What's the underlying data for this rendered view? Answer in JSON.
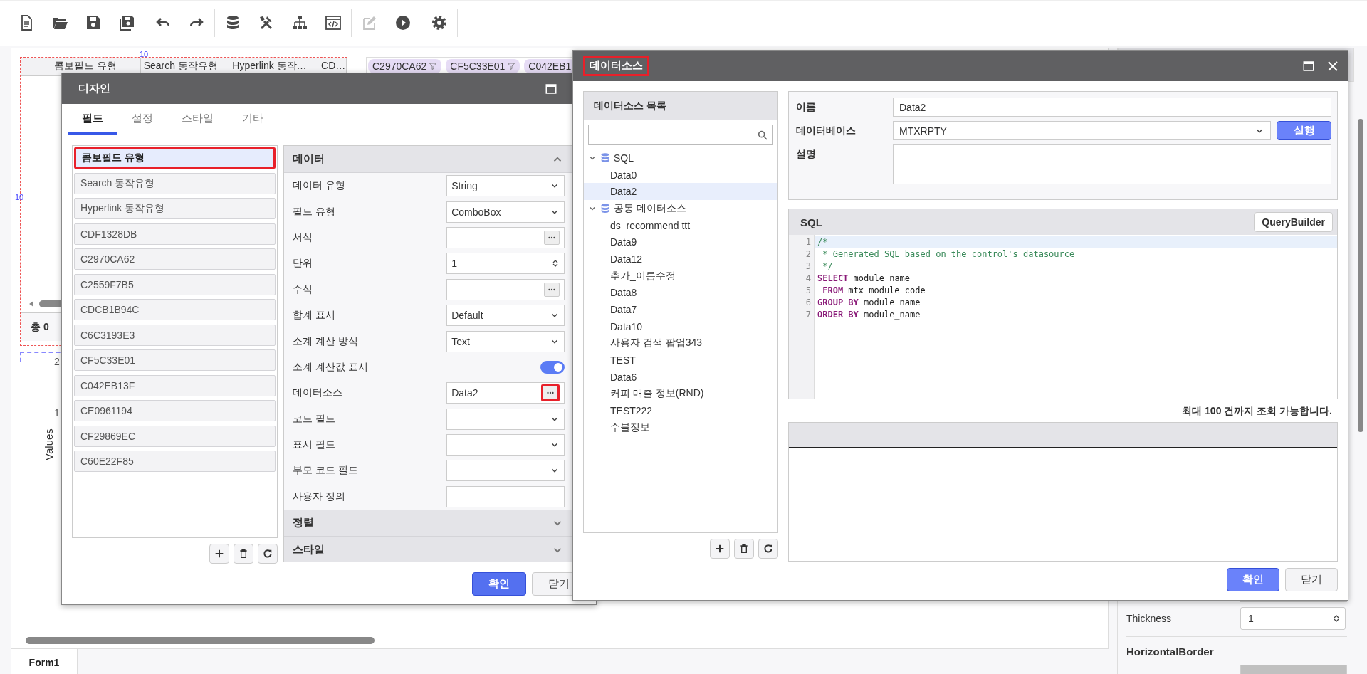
{
  "toolbar": [
    [
      {
        "kind": "new",
        "disabled": false
      },
      {
        "kind": "open",
        "disabled": false
      },
      {
        "kind": "save",
        "disabled": false
      },
      {
        "kind": "saveall",
        "disabled": false
      }
    ],
    [
      {
        "kind": "undo",
        "disabled": false
      },
      {
        "kind": "redo",
        "disabled": false
      }
    ],
    [
      {
        "kind": "database",
        "disabled": false
      },
      {
        "kind": "tools",
        "disabled": false
      },
      {
        "kind": "sitemap",
        "disabled": false
      },
      {
        "kind": "code",
        "disabled": false
      }
    ],
    [
      {
        "kind": "edit",
        "disabled": true
      },
      {
        "kind": "play",
        "disabled": false
      }
    ],
    [
      {
        "kind": "settings",
        "disabled": false
      }
    ]
  ],
  "canvas": {
    "ruler_marks": [
      "10",
      "10"
    ],
    "grid": {
      "columns": [
        "콤보필드 유형",
        "Search 동작유형",
        "Hyperlink 동작…",
        "CD…"
      ],
      "footer": "총 0"
    },
    "filter_chips": [
      "C2970CA62",
      "CF5C33E01",
      "C042EB1"
    ],
    "chart": {
      "ylabel": "Values",
      "ticks": [
        "2",
        "1"
      ]
    }
  },
  "form_tabs": [
    {
      "label": "Form1",
      "selected": true
    }
  ],
  "properties_panel": {
    "thickness_label": "Thickness",
    "thickness": "1",
    "section": "HorizontalBorder"
  },
  "design_dialog": {
    "title": "디자인",
    "tabs": [
      {
        "label": "필드",
        "selected": true
      },
      {
        "label": "설정",
        "selected": false
      },
      {
        "label": "스타일",
        "selected": false
      },
      {
        "label": "기타",
        "selected": false
      }
    ],
    "fields": [
      {
        "label": "콤보필드 유형",
        "selected": true,
        "highlighted": true
      },
      {
        "label": "Search 동작유형",
        "selected": false,
        "highlighted": false
      },
      {
        "label": "Hyperlink 동작유형",
        "selected": false,
        "highlighted": false
      },
      {
        "label": "CDF1328DB",
        "selected": false,
        "highlighted": false
      },
      {
        "label": "C2970CA62",
        "selected": false,
        "highlighted": false
      },
      {
        "label": "C2559F7B5",
        "selected": false,
        "highlighted": false
      },
      {
        "label": "CDCB1B94C",
        "selected": false,
        "highlighted": false
      },
      {
        "label": "C6C3193E3",
        "selected": false,
        "highlighted": false
      },
      {
        "label": "CF5C33E01",
        "selected": false,
        "highlighted": false
      },
      {
        "label": "C042EB13F",
        "selected": false,
        "highlighted": false
      },
      {
        "label": "CE0961194",
        "selected": false,
        "highlighted": false
      },
      {
        "label": "CF29869EC",
        "selected": false,
        "highlighted": false
      },
      {
        "label": "C60E22F85",
        "selected": false,
        "highlighted": false
      }
    ],
    "sections": [
      {
        "title": "데이터",
        "expanded": true,
        "rows": [
          {
            "label": "데이터 유형",
            "kind": "select",
            "value": "String"
          },
          {
            "label": "필드 유형",
            "kind": "select",
            "value": "ComboBox"
          },
          {
            "label": "서식",
            "kind": "browse",
            "highlighted": false
          },
          {
            "label": "단위",
            "kind": "spin",
            "value": "1"
          },
          {
            "label": "수식",
            "kind": "browse",
            "highlighted": false
          },
          {
            "label": "합계 표시",
            "kind": "select",
            "value": "Default"
          },
          {
            "label": "소계 계산 방식",
            "kind": "select",
            "value": "Text"
          },
          {
            "label": "소계 계산값 표시",
            "kind": "toggle",
            "on": true
          },
          {
            "label": "데이터소스",
            "kind": "browse",
            "value": "Data2",
            "highlighted": true
          },
          {
            "label": "코드 필드",
            "kind": "select"
          },
          {
            "label": "표시 필드",
            "kind": "select"
          },
          {
            "label": "부모 코드 필드",
            "kind": "select"
          },
          {
            "label": "사용자 정의",
            "kind": "text"
          }
        ]
      },
      {
        "title": "정렬",
        "expanded": false
      },
      {
        "title": "스타일",
        "expanded": false
      }
    ],
    "buttons": [
      {
        "label": "확인",
        "primary": true
      },
      {
        "label": "닫기",
        "primary": false
      }
    ]
  },
  "datasource_dialog": {
    "title": "데이터소스",
    "title_highlighted": true,
    "list_title": "데이터소스 목록",
    "tree": [
      {
        "label": "SQL",
        "expanded": true,
        "children": [
          {
            "label": "Data0",
            "selected": false
          },
          {
            "label": "Data2",
            "selected": true
          }
        ]
      },
      {
        "label": "공통 데이터소스",
        "expanded": true,
        "children": [
          {
            "label": "ds_recommend ttt",
            "selected": false
          },
          {
            "label": "Data9",
            "selected": false
          },
          {
            "label": "Data12",
            "selected": false
          },
          {
            "label": "추가_이름수정",
            "selected": false
          },
          {
            "label": "Data8",
            "selected": false
          },
          {
            "label": "Data7",
            "selected": false
          },
          {
            "label": "Data10",
            "selected": false
          },
          {
            "label": "사용자 검색 팝업343",
            "selected": false
          },
          {
            "label": "TEST",
            "selected": false
          },
          {
            "label": "Data6",
            "selected": false
          },
          {
            "label": "커피 매출 정보(RND)",
            "selected": false
          },
          {
            "label": "TEST222",
            "selected": false
          },
          {
            "label": "수불정보",
            "selected": false
          }
        ]
      }
    ],
    "name_label": "이름",
    "name": "Data2",
    "database_label": "데이터베이스",
    "database": "MTXRPTY",
    "run_button": "실행",
    "description_label": "설명",
    "sql_title": "SQL",
    "query_builder": "QueryBuilder",
    "sql_lines": [
      {
        "number": "1",
        "tokens": [
          {
            "text": "/*",
            "kind": "comment"
          }
        ]
      },
      {
        "number": "2",
        "tokens": [
          {
            "text": " * Generated SQL based on the control's datasource",
            "kind": "comment"
          }
        ]
      },
      {
        "number": "3",
        "tokens": [
          {
            "text": " */",
            "kind": "comment"
          }
        ]
      },
      {
        "number": "4",
        "tokens": [
          {
            "text": "SELECT",
            "kind": "keyword"
          },
          {
            "text": " module_name",
            "kind": "plain"
          }
        ]
      },
      {
        "number": "5",
        "tokens": [
          {
            "text": " FROM",
            "kind": "keyword"
          },
          {
            "text": " mtx_module_code",
            "kind": "plain"
          }
        ]
      },
      {
        "number": "6",
        "tokens": [
          {
            "text": "GROUP BY",
            "kind": "keyword"
          },
          {
            "text": " module_name",
            "kind": "plain"
          }
        ]
      },
      {
        "number": "7",
        "tokens": [
          {
            "text": "ORDER BY",
            "kind": "keyword"
          },
          {
            "text": " module_name",
            "kind": "plain"
          }
        ]
      }
    ],
    "limit_note": "최대 100 건까지 조회 가능합니다.",
    "buttons": [
      {
        "label": "확인",
        "primary": true
      },
      {
        "label": "닫기",
        "primary": false
      }
    ]
  }
}
